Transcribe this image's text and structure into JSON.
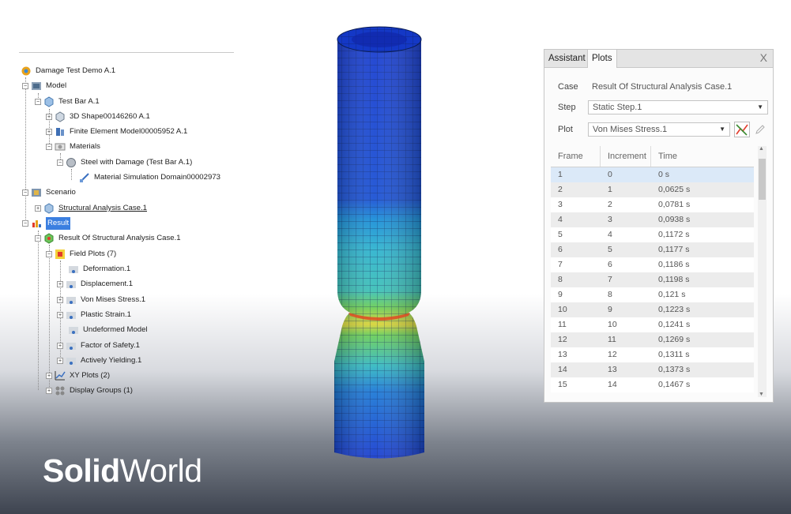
{
  "tree": {
    "root": "Damage Test Demo A.1",
    "model": "Model",
    "test_bar": "Test Bar A.1",
    "shape": "3D Shape00146260 A.1",
    "fem": "Finite Element Model00005952 A.1",
    "materials": "Materials",
    "steel": "Steel with Damage (Test Bar A.1)",
    "domain": "Material Simulation Domain00002973",
    "scenario": "Scenario",
    "case": "Structural Analysis Case.1",
    "result": "Result",
    "result_of": "Result Of Structural Analysis Case.1",
    "field_plots": "Field Plots (7)",
    "fp_items": [
      "Deformation.1",
      "Displacement.1",
      "Von Mises Stress.1",
      "Plastic Strain.1",
      "Undeformed Model",
      "Factor of Safety.1",
      "Actively Yielding.1"
    ],
    "xy_plots": "XY Plots (2)",
    "display_groups": "Display Groups (1)"
  },
  "panel": {
    "tabs": [
      "Assistant",
      "Plots"
    ],
    "active_tab": "Plots",
    "close": "X",
    "case_label": "Case",
    "case_value": "Result Of Structural Analysis Case.1",
    "step_label": "Step",
    "step_value": "Static Step.1",
    "plot_label": "Plot",
    "plot_value": "Von Mises Stress.1",
    "columns": [
      "Frame",
      "Increment",
      "Time"
    ],
    "rows": [
      [
        "1",
        "0",
        "0 s"
      ],
      [
        "2",
        "1",
        "0,0625 s"
      ],
      [
        "3",
        "2",
        "0,0781 s"
      ],
      [
        "4",
        "3",
        "0,0938 s"
      ],
      [
        "5",
        "4",
        "0,1172 s"
      ],
      [
        "6",
        "5",
        "0,1177 s"
      ],
      [
        "7",
        "6",
        "0,1186 s"
      ],
      [
        "8",
        "7",
        "0,1198 s"
      ],
      [
        "9",
        "8",
        "0,121 s"
      ],
      [
        "10",
        "9",
        "0,1223 s"
      ],
      [
        "11",
        "10",
        "0,1241 s"
      ],
      [
        "12",
        "11",
        "0,1269 s"
      ],
      [
        "13",
        "12",
        "0,1311 s"
      ],
      [
        "14",
        "13",
        "0,1373 s"
      ],
      [
        "15",
        "14",
        "0,1467 s"
      ]
    ],
    "selected_row": 0
  },
  "logo": {
    "bold": "Solid",
    "regular": "World"
  },
  "colors": {
    "accent": "#3b7fe0",
    "deep_blue": "#1436c8",
    "mid_blue": "#1e62d8",
    "cyan": "#2fb6c9",
    "green": "#5ec45a",
    "yellow": "#e6d43a",
    "red": "#d9381e"
  }
}
